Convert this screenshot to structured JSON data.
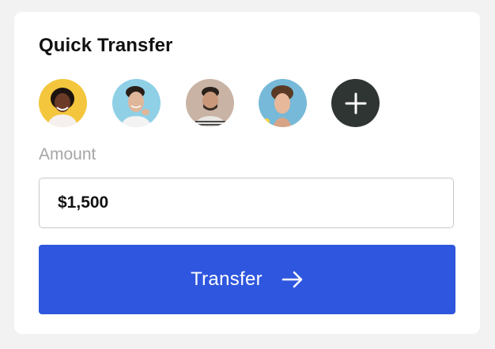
{
  "quick_transfer": {
    "title": "Quick Transfer",
    "recipients": [
      {
        "name": "recipient-1",
        "bg": "#f3c63d"
      },
      {
        "name": "recipient-2",
        "bg": "#8fd0e6"
      },
      {
        "name": "recipient-3",
        "bg": "#c9b3a4"
      },
      {
        "name": "recipient-4",
        "bg": "#77b9d8"
      }
    ],
    "add_icon": "plus-icon",
    "amount_label": "Amount",
    "amount_value": "$1,500",
    "transfer_label": "Transfer",
    "transfer_icon": "arrow-right-icon"
  },
  "colors": {
    "accent": "#2f56de",
    "add_button": "#2f3533",
    "label_gray": "#a6a6a6"
  }
}
